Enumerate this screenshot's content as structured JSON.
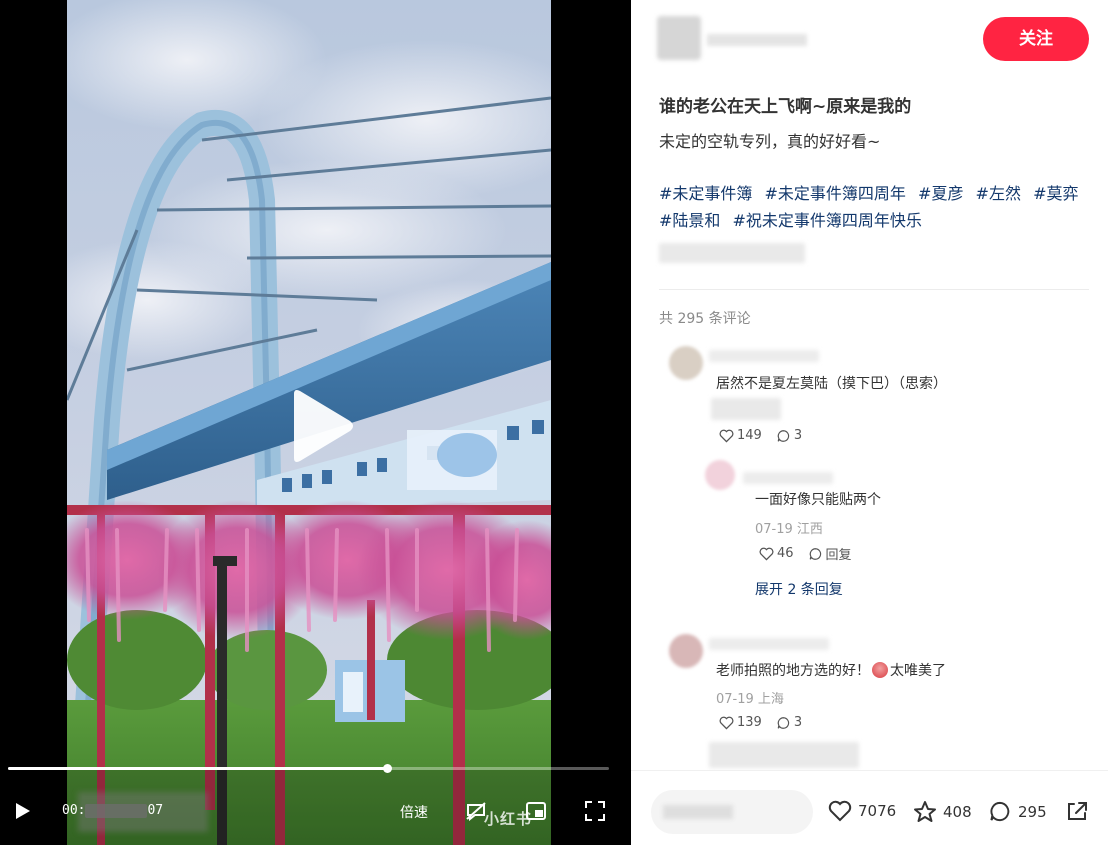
{
  "player": {
    "time_current": "00:",
    "time_total": "07",
    "speed_label": "倍速",
    "watermark": "小红书",
    "progress": 0.63
  },
  "note": {
    "follow_label": "关注",
    "title": "谁的老公在天上飞啊~原来是我的",
    "desc": "未定的空轨专列，真的好好看~",
    "tags": [
      "#未定事件簿",
      "#未定事件簿四周年",
      "#夏彦",
      "#左然",
      "#莫弈",
      "#陆景和",
      "#祝未定事件簿四周年快乐"
    ]
  },
  "comments": {
    "count_label": "共 295 条评论",
    "items": [
      {
        "text": "居然不是夏左莫陆（摸下巴）（思索）",
        "likes": "149",
        "replies": "3"
      },
      {
        "text": "一面好像只能贴两个",
        "meta": "07-19 江西",
        "likes": "46",
        "reply_label": "回复",
        "expand_label": "展开 2 条回复"
      },
      {
        "text_a": "老师拍照的地方选的好！",
        "text_b": "太唯美了",
        "meta": "07-19 上海",
        "likes": "139",
        "replies": "3"
      }
    ]
  },
  "bottom": {
    "likes": "7076",
    "collects": "408",
    "comments": "295"
  },
  "colors": {
    "accent": "#ff2442",
    "tag": "#13386c"
  }
}
